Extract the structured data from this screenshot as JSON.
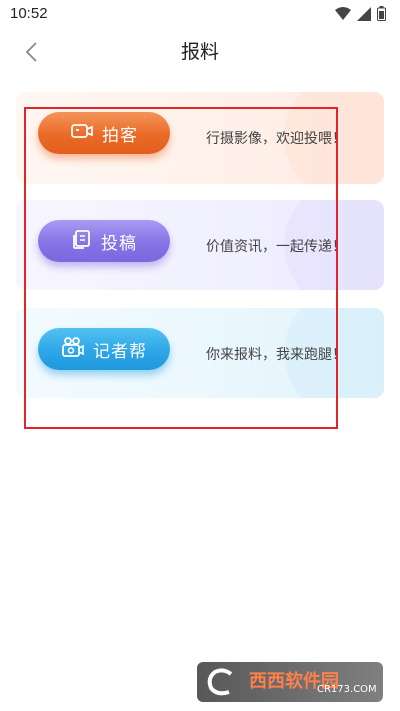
{
  "status_bar": {
    "time": "10:52"
  },
  "header": {
    "title": "报料"
  },
  "cards": [
    {
      "button_label": "拍客",
      "description": "行摄影像，欢迎投喂！"
    },
    {
      "button_label": "投稿",
      "description": "价值资讯，一起传递！"
    },
    {
      "button_label": "记者帮",
      "description": "你来报料，我来跑腿！"
    }
  ],
  "watermark": {
    "logo_text": "西西软件园",
    "sub_text": "CR173.COM"
  },
  "colors": {
    "highlight_border": "#e0262a",
    "pai_accent": "#ea6a28",
    "tou_accent": "#8673e6",
    "ji_accent": "#2ea6e6"
  }
}
